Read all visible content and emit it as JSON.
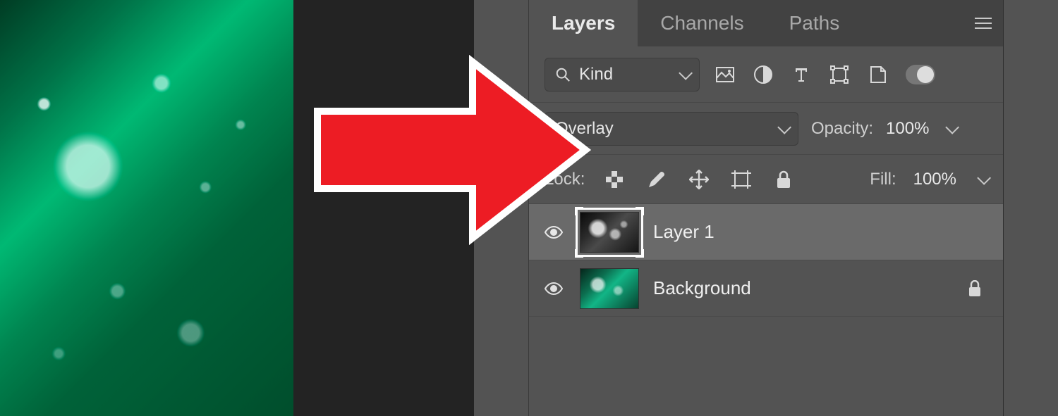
{
  "panel": {
    "tabs": [
      "Layers",
      "Channels",
      "Paths"
    ],
    "active_tab": 0
  },
  "filter": {
    "kind_label": "Kind"
  },
  "blend": {
    "mode": "Overlay",
    "opacity_label": "Opacity:",
    "opacity_value": "100%"
  },
  "lock": {
    "label": "Lock:",
    "fill_label": "Fill:",
    "fill_value": "100%"
  },
  "layers": [
    {
      "name": "Layer 1",
      "selected": true,
      "locked": false
    },
    {
      "name": "Background",
      "selected": false,
      "locked": true
    }
  ]
}
